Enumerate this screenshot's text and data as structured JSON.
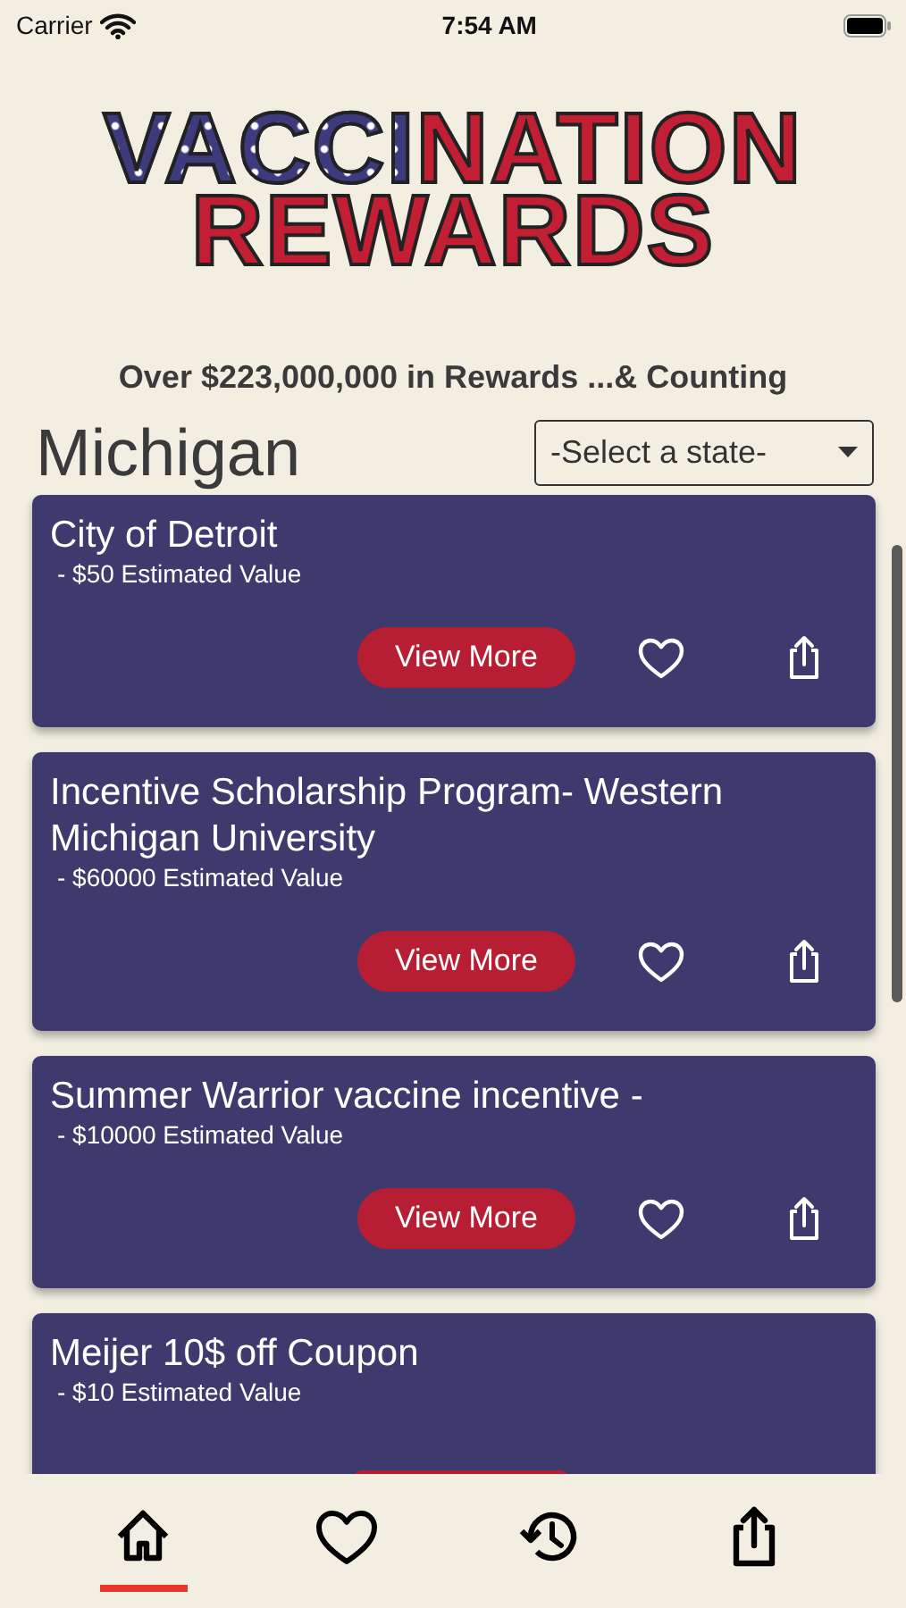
{
  "status_bar": {
    "carrier": "Carrier",
    "time": "7:54 AM"
  },
  "logo": {
    "line1_flag_part": "VACCI",
    "line1_rest": "NATION",
    "line2": "REWARDS"
  },
  "tagline": "Over $223,000,000 in Rewards ...& Counting",
  "state_heading": "Michigan",
  "state_select": {
    "placeholder": "-Select a state-"
  },
  "rewards": [
    {
      "title": "City of Detroit",
      "value": "- $50 Estimated Value",
      "button": "View More",
      "favorite": false
    },
    {
      "title": "Incentive Scholarship Program- Western Michigan University",
      "value": "- $60000 Estimated Value",
      "button": "View More",
      "favorite": false
    },
    {
      "title": "Summer Warrior vaccine incentive -",
      "value": "- $10000 Estimated Value",
      "button": "View More",
      "favorite": false
    },
    {
      "title": "Meijer 10$ off Coupon",
      "value": "- $10 Estimated Value"
    }
  ],
  "tab_bar": [
    {
      "kind": "home",
      "selected": true
    },
    {
      "kind": "favorites",
      "selected": false
    },
    {
      "kind": "history",
      "selected": false
    },
    {
      "kind": "share",
      "selected": false
    }
  ]
}
